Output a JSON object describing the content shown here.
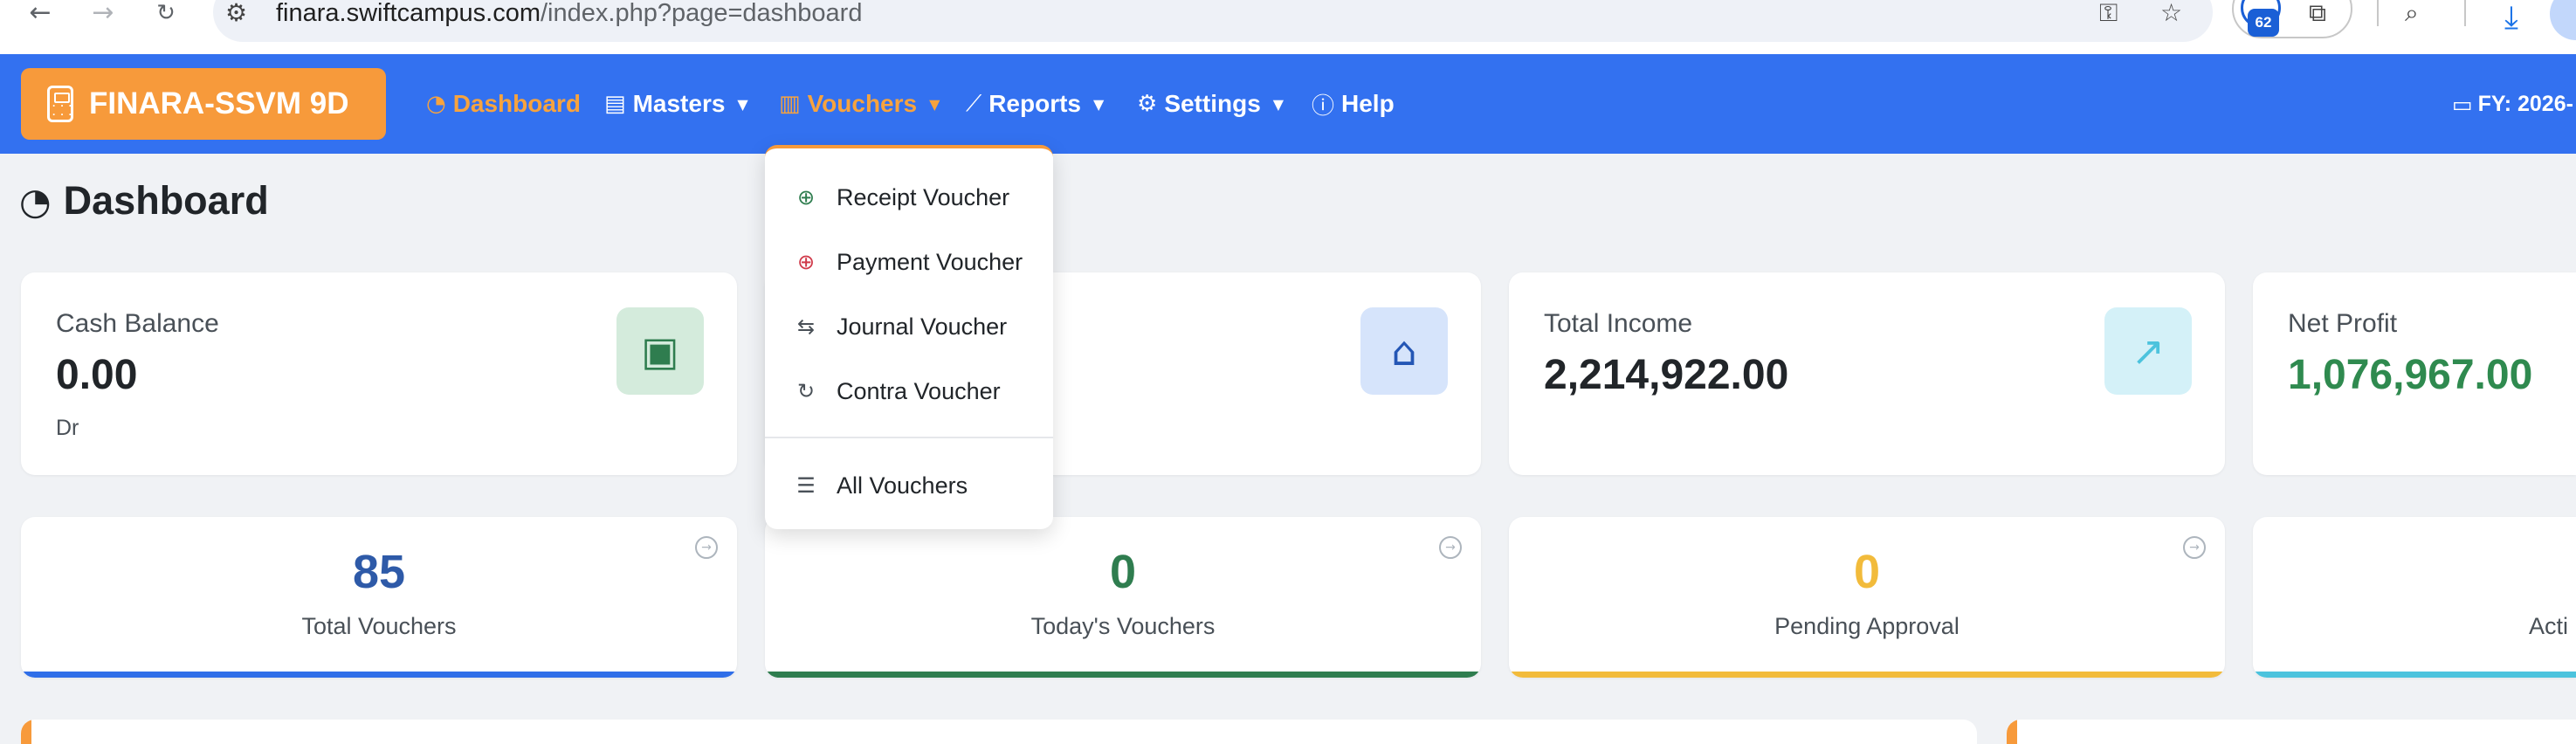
{
  "browser": {
    "url_host": "finara.swiftcampus.com",
    "url_path": "/index.php?page=dashboard",
    "extension_badge": "62"
  },
  "navbar": {
    "brand": "FINARA-SSVM 9D",
    "items": [
      {
        "label": "Dashboard",
        "icon": "gauge-icon"
      },
      {
        "label": "Masters",
        "icon": "book-icon"
      },
      {
        "label": "Vouchers",
        "icon": "receipt-icon"
      },
      {
        "label": "Reports",
        "icon": "chart-line-icon"
      },
      {
        "label": "Settings",
        "icon": "gear-icon"
      },
      {
        "label": "Help",
        "icon": "question-icon"
      }
    ],
    "fy_label": "FY: 2026-"
  },
  "page": {
    "title": "Dashboard"
  },
  "stats": [
    {
      "label": "Cash Balance",
      "value": "0.00",
      "sub": "Dr",
      "icon": "money-icon",
      "icon_bg": "#d4ebdc",
      "icon_color": "#2f7d4f",
      "value_color": "#212529"
    },
    {
      "label": "",
      "value": "",
      "sub": "",
      "icon": "bank-icon",
      "icon_bg": "#d6e4fb",
      "icon_color": "#2456b5",
      "value_color": "#212529"
    },
    {
      "label": "Total Income",
      "value": "2,214,922.00",
      "sub": "",
      "icon": "trend-up-icon",
      "icon_bg": "#d4f1f8",
      "icon_color": "#4cc3dd",
      "value_color": "#212529"
    },
    {
      "label": "Net Profit",
      "value": "1,076,967.00",
      "sub": "",
      "icon": "",
      "icon_bg": "",
      "icon_color": "",
      "value_color": "#2f8a4f"
    }
  ],
  "counts": [
    {
      "value": "85",
      "label": "Total Vouchers",
      "color": "#2e5aa8",
      "bar": "#2f6ee8"
    },
    {
      "value": "0",
      "label": "Today's Vouchers",
      "color": "#2f7d4f",
      "bar": "#2f7d4f"
    },
    {
      "value": "0",
      "label": "Pending Approval",
      "color": "#f2bb3b",
      "bar": "#f2bb3b"
    },
    {
      "value": "",
      "label": "Acti",
      "color": "#212529",
      "bar": "#4cc3dd"
    }
  ],
  "vouchers_menu": {
    "items": [
      {
        "label": "Receipt Voucher",
        "icon": "arrow-down-circle-icon",
        "color": "#2f7d4f"
      },
      {
        "label": "Payment Voucher",
        "icon": "arrow-up-circle-icon",
        "color": "#d03a4a"
      },
      {
        "label": "Journal Voucher",
        "icon": "arrows-left-right-icon",
        "color": "#495057"
      },
      {
        "label": "Contra Voucher",
        "icon": "refresh-icon",
        "color": "#495057"
      }
    ],
    "all_label": "All Vouchers",
    "all_icon": "list-icon"
  }
}
